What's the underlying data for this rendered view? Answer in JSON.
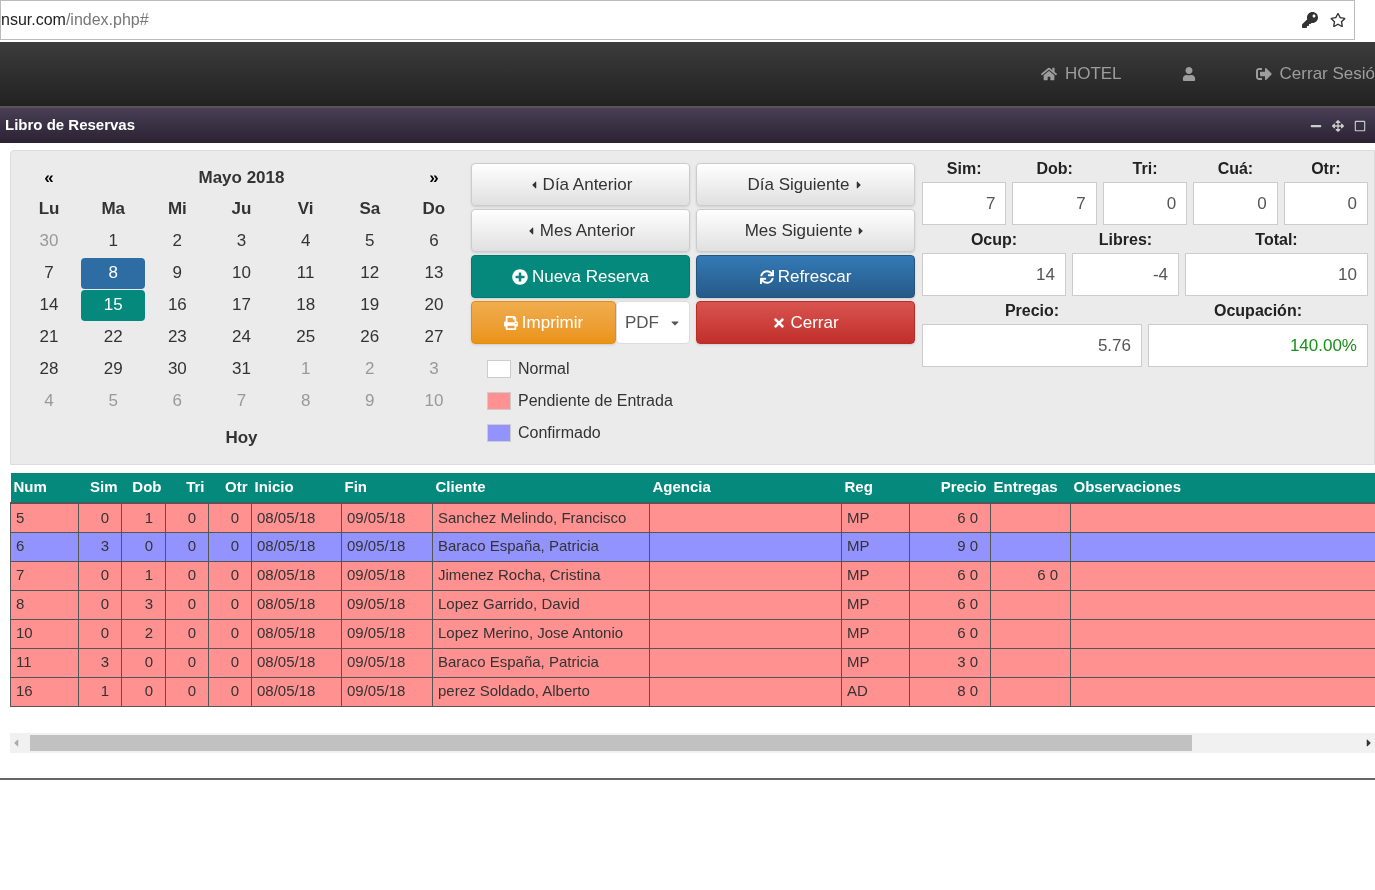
{
  "browser": {
    "url_host": "nsur.com",
    "url_path": "/index.php#"
  },
  "navbar": {
    "items": [
      {
        "label": "HOTEL",
        "kind": "home"
      },
      {
        "kind": "user"
      },
      {
        "label": "Cerrar Sesió",
        "kind": "logout"
      }
    ]
  },
  "panel": {
    "title": "Libro de Reservas"
  },
  "calendar": {
    "prev": "«",
    "title": "Mayo 2018",
    "next": "»",
    "weekdays": [
      "Lu",
      "Ma",
      "Mi",
      "Ju",
      "Vi",
      "Sa",
      "Do"
    ],
    "today_label": "Hoy",
    "days": [
      {
        "d": "30",
        "muted": true,
        "selected": false,
        "today": false
      },
      {
        "d": "1",
        "muted": false,
        "selected": false,
        "today": false
      },
      {
        "d": "2",
        "muted": false,
        "selected": false,
        "today": false
      },
      {
        "d": "3",
        "muted": false,
        "selected": false,
        "today": false
      },
      {
        "d": "4",
        "muted": false,
        "selected": false,
        "today": false
      },
      {
        "d": "5",
        "muted": false,
        "selected": false,
        "today": false
      },
      {
        "d": "6",
        "muted": false,
        "selected": false,
        "today": false
      },
      {
        "d": "7",
        "muted": false,
        "selected": false,
        "today": false
      },
      {
        "d": "8",
        "muted": false,
        "selected": true,
        "today": false
      },
      {
        "d": "9",
        "muted": false,
        "selected": false,
        "today": false
      },
      {
        "d": "10",
        "muted": false,
        "selected": false,
        "today": false
      },
      {
        "d": "11",
        "muted": false,
        "selected": false,
        "today": false
      },
      {
        "d": "12",
        "muted": false,
        "selected": false,
        "today": false
      },
      {
        "d": "13",
        "muted": false,
        "selected": false,
        "today": false
      },
      {
        "d": "14",
        "muted": false,
        "selected": false,
        "today": false
      },
      {
        "d": "15",
        "muted": false,
        "selected": false,
        "today": true
      },
      {
        "d": "16",
        "muted": false,
        "selected": false,
        "today": false
      },
      {
        "d": "17",
        "muted": false,
        "selected": false,
        "today": false
      },
      {
        "d": "18",
        "muted": false,
        "selected": false,
        "today": false
      },
      {
        "d": "19",
        "muted": false,
        "selected": false,
        "today": false
      },
      {
        "d": "20",
        "muted": false,
        "selected": false,
        "today": false
      },
      {
        "d": "21",
        "muted": false,
        "selected": false,
        "today": false
      },
      {
        "d": "22",
        "muted": false,
        "selected": false,
        "today": false
      },
      {
        "d": "23",
        "muted": false,
        "selected": false,
        "today": false
      },
      {
        "d": "24",
        "muted": false,
        "selected": false,
        "today": false
      },
      {
        "d": "25",
        "muted": false,
        "selected": false,
        "today": false
      },
      {
        "d": "26",
        "muted": false,
        "selected": false,
        "today": false
      },
      {
        "d": "27",
        "muted": false,
        "selected": false,
        "today": false
      },
      {
        "d": "28",
        "muted": false,
        "selected": false,
        "today": false
      },
      {
        "d": "29",
        "muted": false,
        "selected": false,
        "today": false
      },
      {
        "d": "30",
        "muted": false,
        "selected": false,
        "today": false
      },
      {
        "d": "31",
        "muted": false,
        "selected": false,
        "today": false
      },
      {
        "d": "1",
        "muted": true,
        "selected": false,
        "today": false
      },
      {
        "d": "2",
        "muted": true,
        "selected": false,
        "today": false
      },
      {
        "d": "3",
        "muted": true,
        "selected": false,
        "today": false
      },
      {
        "d": "4",
        "muted": true,
        "selected": false,
        "today": false
      },
      {
        "d": "5",
        "muted": true,
        "selected": false,
        "today": false
      },
      {
        "d": "6",
        "muted": true,
        "selected": false,
        "today": false
      },
      {
        "d": "7",
        "muted": true,
        "selected": false,
        "today": false
      },
      {
        "d": "8",
        "muted": true,
        "selected": false,
        "today": false
      },
      {
        "d": "9",
        "muted": true,
        "selected": false,
        "today": false
      },
      {
        "d": "10",
        "muted": true,
        "selected": false,
        "today": false
      }
    ]
  },
  "buttons": [
    {
      "label": "Día Anterior",
      "kind": "prev"
    },
    {
      "label": "Día Siguiente",
      "kind": "next"
    },
    {
      "label": "Mes Anterior",
      "kind": "prev"
    },
    {
      "label": "Mes Siguiente",
      "kind": "next"
    },
    {
      "label": "Nueva Reserva",
      "kind": "new"
    },
    {
      "label": "Refrescar",
      "kind": "refresh"
    },
    {
      "label": "Imprimir",
      "kind": "print"
    },
    {
      "label": "Cerrar",
      "kind": "close"
    }
  ],
  "format_select": {
    "value": "PDF"
  },
  "legend": [
    {
      "label": "Normal",
      "color": "#ffffff"
    },
    {
      "label": "Pendiente de Entrada",
      "color": "#ff9191"
    },
    {
      "label": "Confirmado",
      "color": "#9393ff"
    }
  ],
  "stats": {
    "row1": [
      {
        "label": "Sim:",
        "value": "7"
      },
      {
        "label": "Dob:",
        "value": "7"
      },
      {
        "label": "Tri:",
        "value": "0"
      },
      {
        "label": "Cuá:",
        "value": "0"
      },
      {
        "label": "Otr:",
        "value": "0"
      }
    ],
    "row2": [
      {
        "label": "Ocup:",
        "value": "14"
      },
      {
        "label": "Libres:",
        "value": "-4"
      },
      {
        "label": "Total:",
        "value": "10"
      }
    ],
    "row3": [
      {
        "label": "Precio:",
        "value": "5.76"
      },
      {
        "label": "Ocupación:",
        "value": "140.00%"
      }
    ]
  },
  "table": {
    "columns": [
      "Num",
      "Sim",
      "Dob",
      "Tri",
      "Otr",
      "Inicio",
      "Fin",
      "Cliente",
      "Agencia",
      "Reg",
      "Precio",
      "Entregas",
      "Observaciones"
    ],
    "rows": [
      {
        "color": "#ff9191",
        "cells": [
          "5",
          "0",
          "1",
          "0",
          "0",
          "08/05/18",
          "09/05/18",
          "Sanchez Melindo, Francisco",
          "",
          "MP",
          "6 0",
          "",
          ""
        ]
      },
      {
        "color": "#9393ff",
        "cells": [
          "6",
          "3",
          "0",
          "0",
          "0",
          "08/05/18",
          "09/05/18",
          "Baraco España, Patricia",
          "",
          "MP",
          "9 0",
          "",
          ""
        ]
      },
      {
        "color": "#ff9191",
        "cells": [
          "7",
          "0",
          "1",
          "0",
          "0",
          "08/05/18",
          "09/05/18",
          "Jimenez Rocha, Cristina",
          "",
          "MP",
          "6 0",
          "6 0",
          ""
        ]
      },
      {
        "color": "#ff9191",
        "cells": [
          "8",
          "0",
          "3",
          "0",
          "0",
          "08/05/18",
          "09/05/18",
          "Lopez Garrido, David",
          "",
          "MP",
          "6 0",
          "",
          ""
        ]
      },
      {
        "color": "#ff9191",
        "cells": [
          "10",
          "0",
          "2",
          "0",
          "0",
          "08/05/18",
          "09/05/18",
          "Lopez Merino, Jose Antonio",
          "",
          "MP",
          "6 0",
          "",
          ""
        ]
      },
      {
        "color": "#ff9191",
        "cells": [
          "11",
          "3",
          "0",
          "0",
          "0",
          "08/05/18",
          "09/05/18",
          "Baraco España, Patricia",
          "",
          "MP",
          "3 0",
          "",
          ""
        ]
      },
      {
        "color": "#ff9191",
        "cells": [
          "16",
          "1",
          "0",
          "0",
          "0",
          "08/05/18",
          "09/05/18",
          "perez Soldado, Alberto",
          "",
          "AD",
          "8 0",
          "",
          ""
        ]
      }
    ]
  }
}
